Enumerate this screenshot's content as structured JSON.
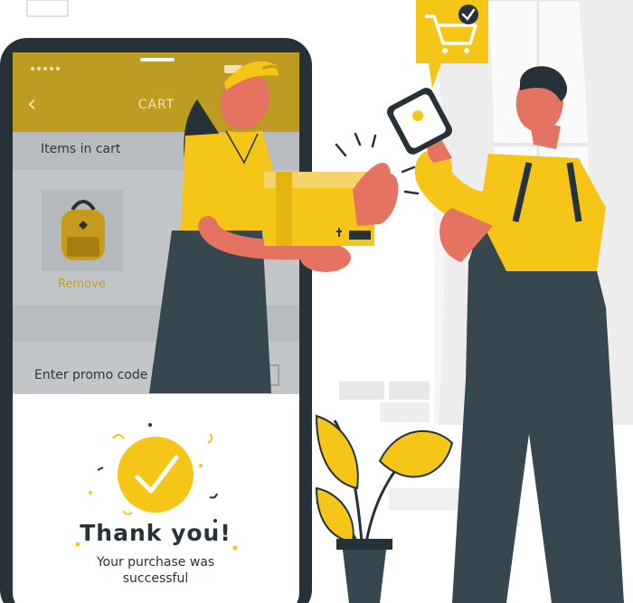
{
  "phone": {
    "screen_title": "CART",
    "back_icon": "chevron-left-icon",
    "items_in_cart_label": "Items in cart",
    "cart_item_icon": "backpack-icon",
    "remove_label": "Remove",
    "promo_label": "Enter promo code",
    "success_icon": "checkmark-circle-icon",
    "thank_you_title": "Thank you!",
    "purchase_message_line1": "Your purchase was",
    "purchase_message_line2": "successful"
  },
  "speech_bubble_icon": "shopping-cart-check-icon",
  "colors": {
    "accent_yellow": "#f5c518",
    "dark_slate": "#37474f",
    "overlay_dark": "#263238",
    "skin": "#e57361",
    "window_gray": "#e0e0e0"
  }
}
